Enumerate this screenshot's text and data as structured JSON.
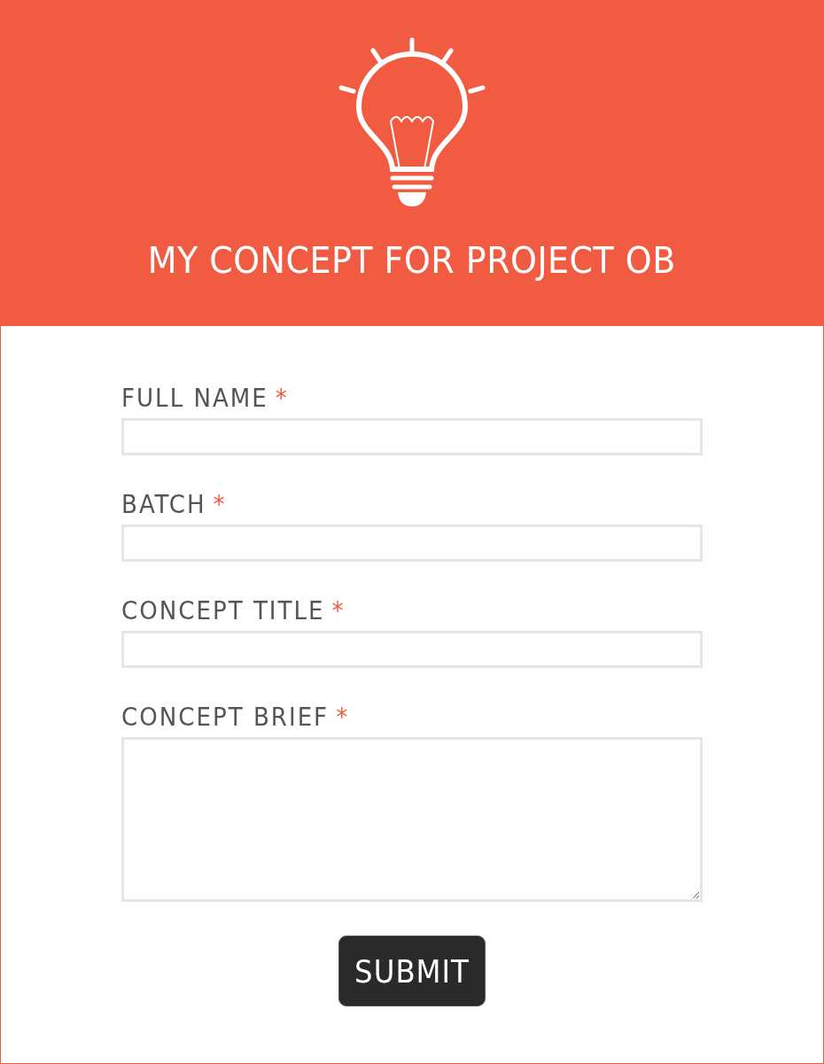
{
  "header": {
    "title": "MY CONCEPT FOR PROJECT OB"
  },
  "fields": [
    {
      "kind": "text",
      "label": "FULL NAME",
      "required_mark": "*"
    },
    {
      "kind": "text",
      "label": "BATCH",
      "required_mark": "*"
    },
    {
      "kind": "text",
      "label": "CONCEPT TITLE",
      "required_mark": "*"
    },
    {
      "kind": "textarea",
      "label": "CONCEPT BRIEF",
      "required_mark": "*"
    }
  ],
  "submit_button": "SUBMIT"
}
